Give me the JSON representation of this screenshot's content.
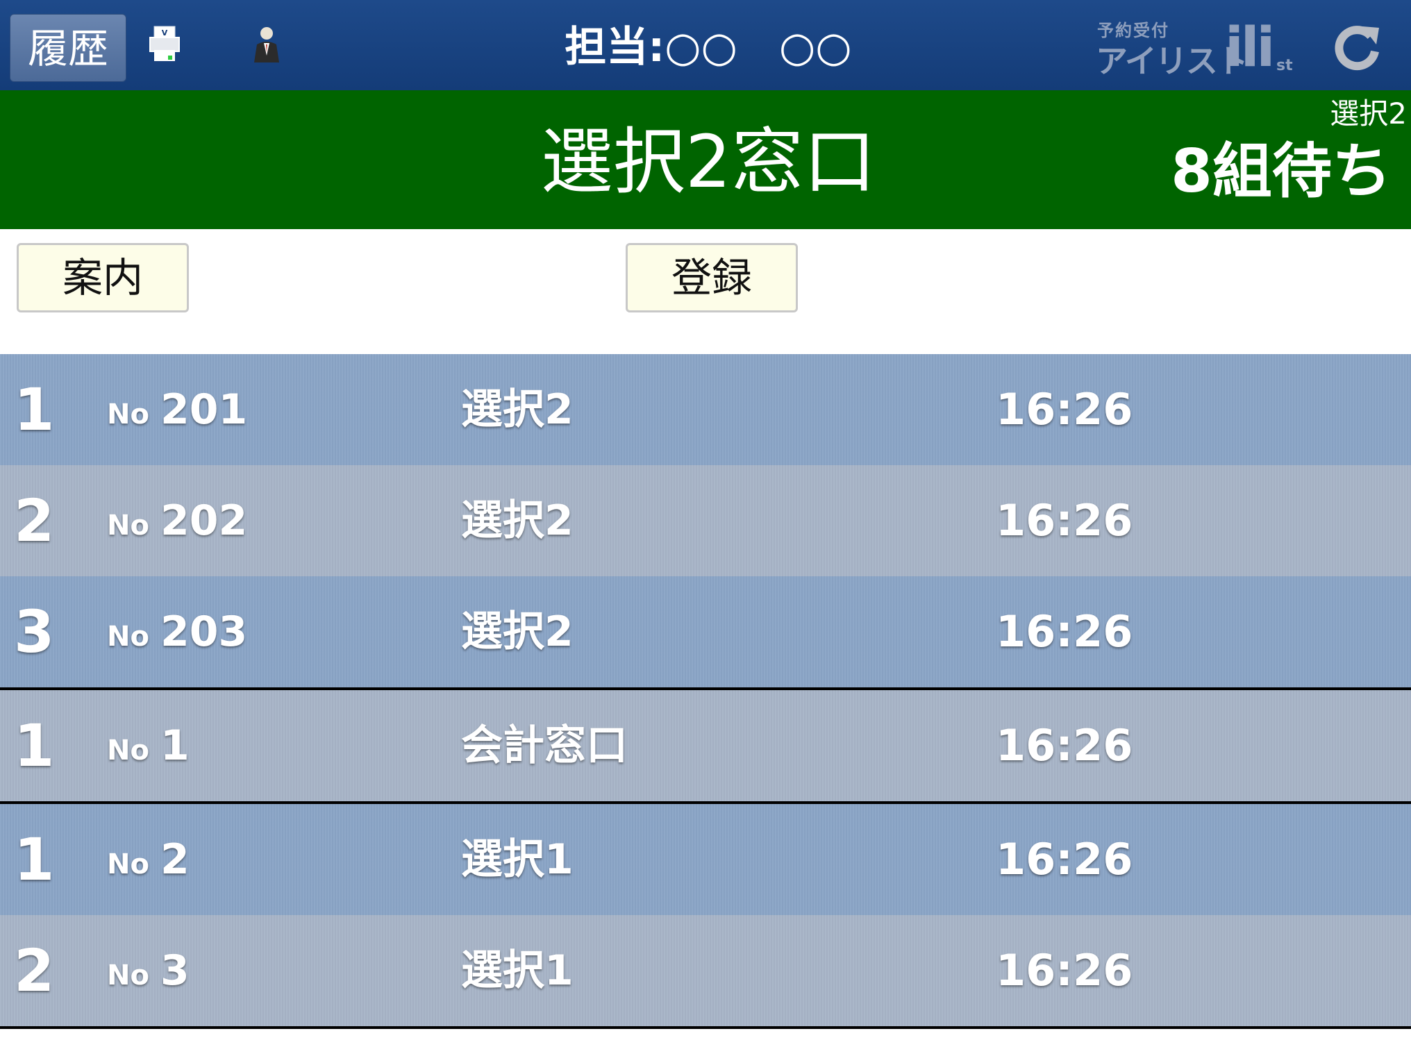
{
  "topbar": {
    "history_label": "履歴",
    "staff_label": "担当:○○　○○",
    "brand_small": "予約受付",
    "brand_big": "アイリスト",
    "brand_mark": "ili",
    "brand_suffix": "st",
    "icons": [
      "printer-icon",
      "staff-person-icon",
      "refresh-icon"
    ]
  },
  "header": {
    "window_title": "選択2窓口",
    "queue_window": "選択2",
    "queue_count": "8組待ち",
    "color": "#006400"
  },
  "actions": {
    "guide_label": "案内",
    "register_label": "登録"
  },
  "queue": [
    {
      "rank": "1",
      "no_label": "No",
      "number": "201",
      "window": "選択2",
      "time": "16:26"
    },
    {
      "rank": "2",
      "no_label": "No",
      "number": "202",
      "window": "選択2",
      "time": "16:26"
    },
    {
      "rank": "3",
      "no_label": "No",
      "number": "203",
      "window": "選択2",
      "time": "16:26"
    },
    {
      "rank": "1",
      "no_label": "No",
      "number": "1",
      "window": "会計窓口",
      "time": "16:26"
    },
    {
      "rank": "1",
      "no_label": "No",
      "number": "2",
      "window": "選択1",
      "time": "16:26"
    },
    {
      "rank": "2",
      "no_label": "No",
      "number": "3",
      "window": "選択1",
      "time": "16:26"
    }
  ]
}
